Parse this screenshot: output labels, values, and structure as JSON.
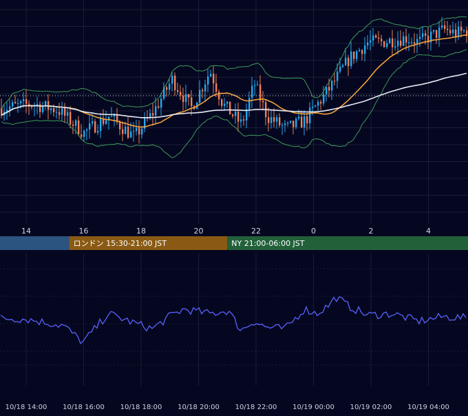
{
  "colors": {
    "background": "#050720",
    "grid": "#1a1e38",
    "axis_text": "#d0d4e4",
    "candle_up": "#26a8f0",
    "candle_down": "#f08058",
    "bollinger": "#3f9a5a",
    "ma_fast": "#f3a33c",
    "ma_slow": "#e8ecf4",
    "reference_line": "#e4e4e4",
    "oscillator": "#5a62ff",
    "session_tokyo": "#2c5480",
    "session_london": "#8a5a14",
    "session_ny": "#22603a"
  },
  "chart_data": [
    {
      "type": "candlestick",
      "x_tick_labels": [
        "14",
        "16",
        "18",
        "20",
        "22",
        "0",
        "2",
        "4"
      ],
      "series": [
        {
          "type": "candlestick",
          "anchors": [
            [
              0,
              -0.3
            ],
            [
              5,
              -0.2
            ],
            [
              9,
              -0.35
            ],
            [
              13,
              -0.9
            ],
            [
              17,
              -0.5
            ],
            [
              21,
              -1.0
            ],
            [
              24,
              -0.4
            ],
            [
              27,
              0.4
            ],
            [
              30,
              -0.3
            ],
            [
              33,
              0.6
            ],
            [
              35,
              -0.2
            ],
            [
              38,
              -0.7
            ],
            [
              40,
              0.3
            ],
            [
              42,
              -0.5
            ],
            [
              45,
              -0.8
            ],
            [
              48,
              -0.6
            ],
            [
              50,
              -0.2
            ],
            [
              52,
              0.2
            ],
            [
              55,
              0.9
            ],
            [
              58,
              1.3
            ],
            [
              60,
              1.3
            ],
            [
              64,
              1.4
            ],
            [
              66,
              1.3
            ],
            [
              70,
              1.6
            ],
            [
              72,
              1.5
            ],
            [
              74,
              1.6
            ]
          ]
        },
        {
          "type": "bollinger-band",
          "upper_and_lower": true
        },
        {
          "type": "moving-average",
          "variant": "fast"
        },
        {
          "type": "moving-average",
          "variant": "slow"
        },
        {
          "type": "horizontal-line",
          "style": "dotted",
          "y": 0
        }
      ],
      "sessions": [
        {
          "label": "",
          "start_hour": 13,
          "end_hour": 15.5
        },
        {
          "label": "ロンドン 15:30-21:00 JST",
          "start_hour": 15.5,
          "end_hour": 21
        },
        {
          "label": "NY 21:00-06:00 JST",
          "start_hour": 21,
          "end_hour": 30
        }
      ]
    },
    {
      "type": "line",
      "x_tick_labels": [
        "10/18 14:00",
        "10/18 16:00",
        "10/18 18:00",
        "10/18 20:00",
        "10/18 22:00",
        "10/19 00:00",
        "10/19 02:00",
        "10/19 04:00"
      ],
      "anchors": [
        [
          0,
          0
        ],
        [
          4,
          -0.05
        ],
        [
          10,
          -0.5
        ],
        [
          13,
          -1.6
        ],
        [
          17,
          0.3
        ],
        [
          21,
          -0.3
        ],
        [
          24,
          -0.7
        ],
        [
          27,
          0.2
        ],
        [
          29,
          0.6
        ],
        [
          33,
          0.3
        ],
        [
          36,
          0.5
        ],
        [
          38,
          -0.8
        ],
        [
          40,
          -0.2
        ],
        [
          42,
          -0.6
        ],
        [
          45,
          -0.7
        ],
        [
          48,
          0.6
        ],
        [
          50,
          0.3
        ],
        [
          52,
          0.9
        ],
        [
          53,
          1.4
        ],
        [
          55,
          0.8
        ],
        [
          58,
          0.2
        ],
        [
          62,
          0.3
        ],
        [
          66,
          -0.2
        ],
        [
          70,
          0.1
        ],
        [
          74,
          0.0
        ]
      ]
    }
  ]
}
